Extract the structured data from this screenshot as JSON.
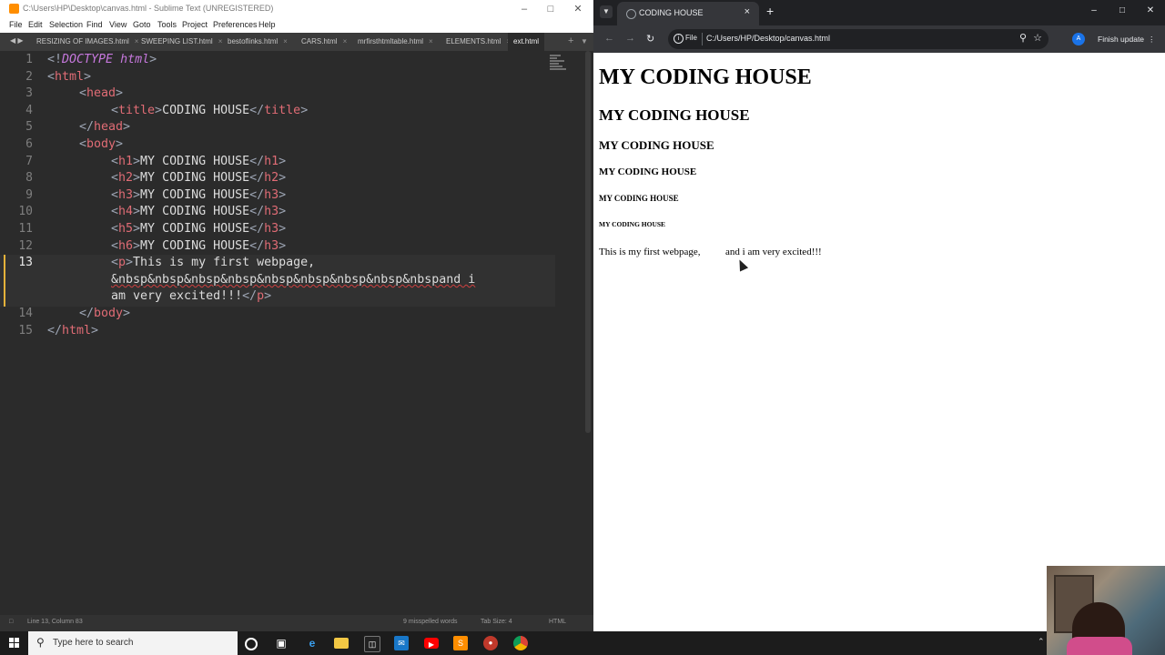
{
  "sublime": {
    "title": "C:\\Users\\HP\\Desktop\\canvas.html - Sublime Text (UNREGISTERED)",
    "menu": [
      "File",
      "Edit",
      "Selection",
      "Find",
      "View",
      "Goto",
      "Tools",
      "Project",
      "Preferences",
      "Help"
    ],
    "tabs": [
      {
        "label": "RESIZING OF IMAGES.html",
        "active": false
      },
      {
        "label": "SWEEPING LIST.html",
        "active": false
      },
      {
        "label": "bestoflinks.html",
        "active": false
      },
      {
        "label": "CARS.html",
        "active": false
      },
      {
        "label": "mrfirsthtmltable.html",
        "active": false
      },
      {
        "label": "ELEMENTS.html",
        "active": false
      },
      {
        "label": "ext.html",
        "active": true
      }
    ],
    "line_numbers": [
      "1",
      "2",
      "3",
      "4",
      "5",
      "6",
      "7",
      "8",
      "9",
      "10",
      "11",
      "12",
      "13",
      "14",
      "15"
    ],
    "current_line": "13",
    "code": {
      "l1": {
        "a": "<!",
        "b": "DOCTYPE",
        "c": " html",
        "d": ">"
      },
      "l2": {
        "a": "<",
        "b": "html",
        "c": ">"
      },
      "l3": {
        "a": "<",
        "b": "head",
        "c": ">"
      },
      "l4": {
        "a": "<",
        "b": "title",
        "c": ">",
        "d": "CODING HOUSE",
        "e": "</",
        "f": "title",
        "g": ">"
      },
      "l5": {
        "a": "</",
        "b": "head",
        "c": ">"
      },
      "l6": {
        "a": "<",
        "b": "body",
        "c": ">"
      },
      "l7": {
        "a": "<",
        "b": "h1",
        "c": ">",
        "d": "MY CODING HOUSE",
        "e": "</",
        "f": "h1",
        "g": ">"
      },
      "l8": {
        "a": "<",
        "b": "h2",
        "c": ">",
        "d": "MY CODING HOUSE",
        "e": "</",
        "f": "h2",
        "g": ">"
      },
      "l9": {
        "a": "<",
        "b": "h3",
        "c": ">",
        "d": "MY CODING HOUSE",
        "e": "</",
        "f": "h3",
        "g": ">"
      },
      "l10": {
        "a": "<",
        "b": "h4",
        "c": ">",
        "d": "MY CODING HOUSE",
        "e": "</",
        "f": "h3",
        "g": ">"
      },
      "l11": {
        "a": "<",
        "b": "h5",
        "c": ">",
        "d": "MY CODING HOUSE",
        "e": "</",
        "f": "h3",
        "g": ">"
      },
      "l12": {
        "a": "<",
        "b": "h6",
        "c": ">",
        "d": "MY CODING HOUSE",
        "e": "</",
        "f": "h3",
        "g": ">"
      },
      "l13a": {
        "a": "<",
        "b": "p",
        "c": ">",
        "d": "This is my first webpage,"
      },
      "l13b": {
        "d": "&nbsp&nbsp&nbsp&nbsp&nbsp&nbsp&nbsp&nbsp&nbspand i"
      },
      "l13c": {
        "d": "am very excited!!!",
        "e": "</",
        "f": "p",
        "g": ">"
      },
      "l14": {
        "a": "</",
        "b": "body",
        "c": ">"
      },
      "l15": {
        "a": "</",
        "b": "html",
        "c": ">"
      }
    },
    "status": {
      "position": "Line 13, Column 83",
      "spelling": "9 misspelled words",
      "tab_size": "Tab Size: 4",
      "syntax": "HTML"
    }
  },
  "chrome": {
    "tab_title": "CODING HOUSE",
    "url_scheme": "File",
    "url": "C:/Users/HP/Desktop/canvas.html",
    "avatar": "A",
    "update_label": "Finish update",
    "page": {
      "h1": "MY CODING HOUSE",
      "h2": "MY CODING HOUSE",
      "h3": "MY CODING HOUSE",
      "h4": "MY CODING HOUSE",
      "h5": "MY CODING HOUSE",
      "h6": "MY CODING HOUSE",
      "paragraph": "This is my first webpage,          and i am very excited!!!"
    }
  },
  "taskbar": {
    "search_placeholder": "Type here to search",
    "icons": [
      "cortana-icon",
      "task-view-icon",
      "edge-icon",
      "file-explorer-icon",
      "store-icon",
      "mail-icon",
      "youtube-icon",
      "sublime-icon",
      "app-icon",
      "chrome-icon"
    ]
  },
  "colors": {
    "tag": "#e06c75",
    "editor_bg": "#2b2b2b",
    "line_highlight": "#e4b23a",
    "chrome_dark": "#202124"
  }
}
